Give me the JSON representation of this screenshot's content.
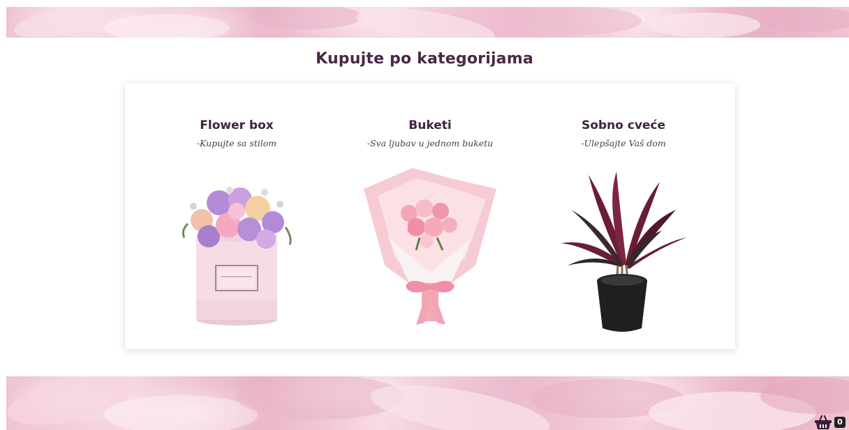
{
  "section": {
    "title": "Kupujte po kategorijama"
  },
  "categories": [
    {
      "name": "Flower box",
      "tagline": "-Kupujte sa stilom",
      "image": "flower-box-image"
    },
    {
      "name": "Buketi",
      "tagline": "-Sva ljubav u jednom buketu",
      "image": "bouquet-image"
    },
    {
      "name": "Sobno cveće",
      "tagline": "-Ulepšajte Vaš dom",
      "image": "potted-plant-image"
    }
  ],
  "cart": {
    "icon": "basket-icon",
    "count": "0"
  },
  "colors": {
    "title": "#4a2747",
    "petal_pink": "#efc3d3",
    "card_bg": "#ffffff"
  }
}
